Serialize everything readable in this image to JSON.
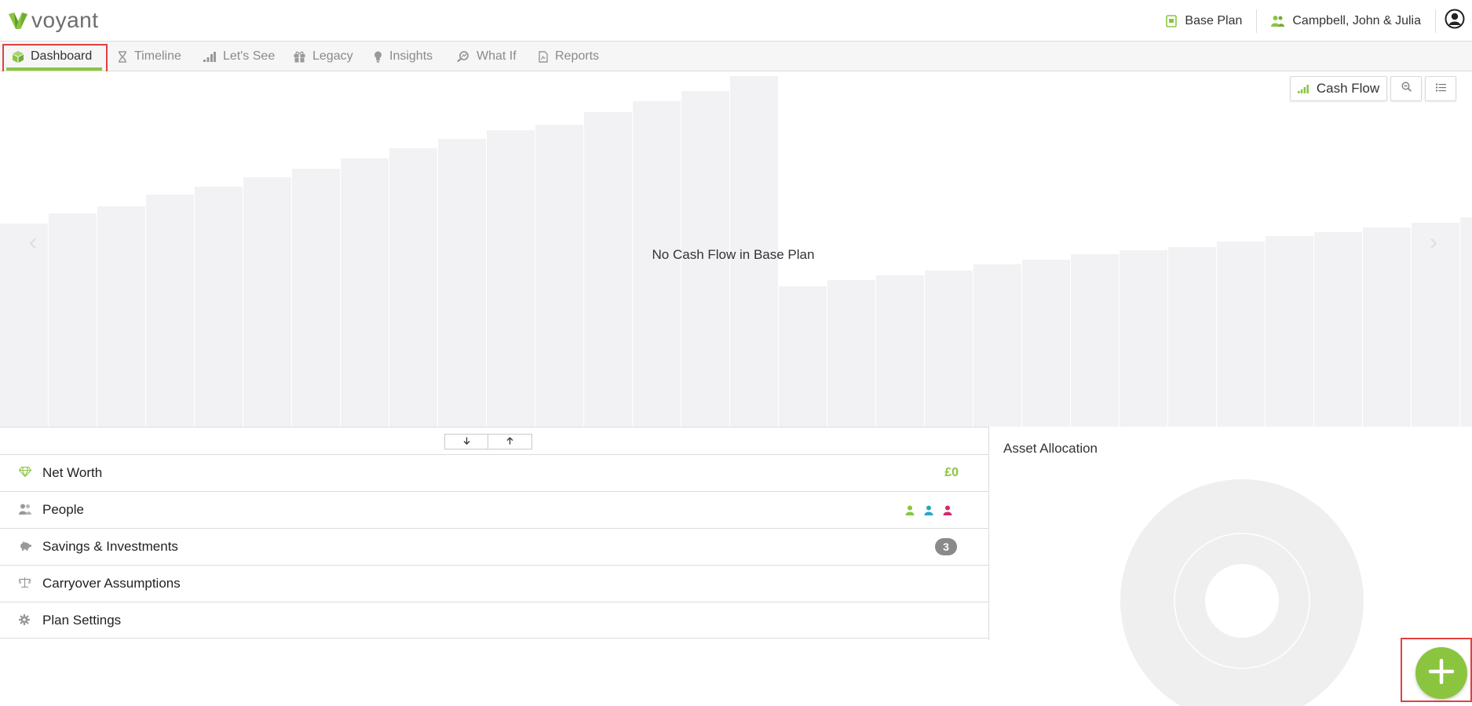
{
  "app": {
    "logo_text": "voyant"
  },
  "header": {
    "plan_label": "Base Plan",
    "client_label": "Campbell, John & Julia"
  },
  "tabs": [
    {
      "label": "Dashboard",
      "icon": "cube-icon",
      "active": true
    },
    {
      "label": "Timeline",
      "icon": "hourglass-icon"
    },
    {
      "label": "Let's See",
      "icon": "bar-chart-icon"
    },
    {
      "label": "Legacy",
      "icon": "gift-icon"
    },
    {
      "label": "Insights",
      "icon": "lightbulb-icon"
    },
    {
      "label": "What If",
      "icon": "search-chart-icon"
    },
    {
      "label": "Reports",
      "icon": "document-icon"
    }
  ],
  "chart": {
    "empty_message": "No Cash Flow in Base Plan",
    "view_button": "Cash Flow"
  },
  "summary": {
    "net_worth": {
      "label": "Net Worth",
      "value": "£0"
    },
    "people": {
      "label": "People"
    },
    "savings": {
      "label": "Savings & Investments",
      "count": "3"
    },
    "carryover": {
      "label": "Carryover Assumptions"
    },
    "plan_settings": {
      "label": "Plan Settings"
    }
  },
  "asset_allocation": {
    "title": "Asset Allocation"
  },
  "colors": {
    "accent": "#8bc540",
    "person_1": "#8bc540",
    "person_2": "#2aa6c4",
    "person_3": "#d4296e",
    "highlight": "#e0403f"
  }
}
